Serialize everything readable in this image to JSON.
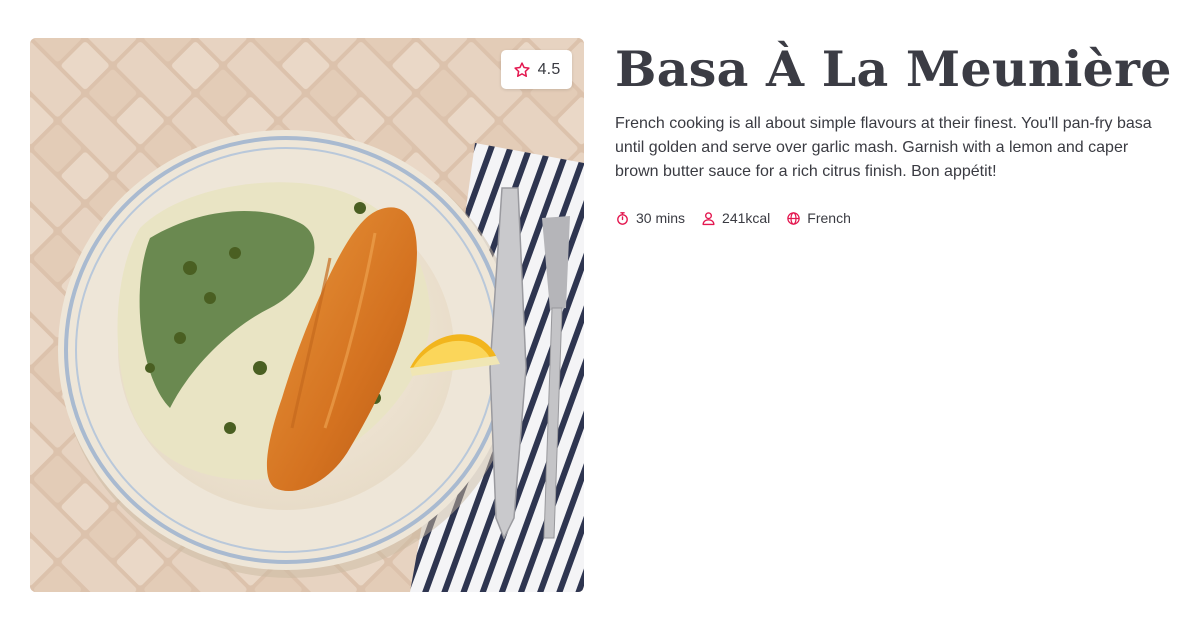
{
  "recipe": {
    "title": "Basa À La Meunière",
    "description": "French cooking is all about simple flavours at their finest. You'll pan-fry basa until golden and serve over garlic mash. Garnish with a lemon and caper brown butter sauce for a rich citrus finish. Bon appétit!",
    "rating": "4.5",
    "image_alt": "Pan-fried basa fillet on garlic mash with spinach, capers and a lemon wedge",
    "meta": {
      "time": "30 mins",
      "calories": "241kcal",
      "cuisine": "French"
    }
  },
  "icons": {
    "rating": "star-icon",
    "time": "stopwatch-icon",
    "calories": "person-icon",
    "cuisine": "globe-icon"
  },
  "colors": {
    "accent": "#e3174f",
    "title": "#3b3c44",
    "text": "#3a3b42",
    "background": "#ffffff"
  }
}
